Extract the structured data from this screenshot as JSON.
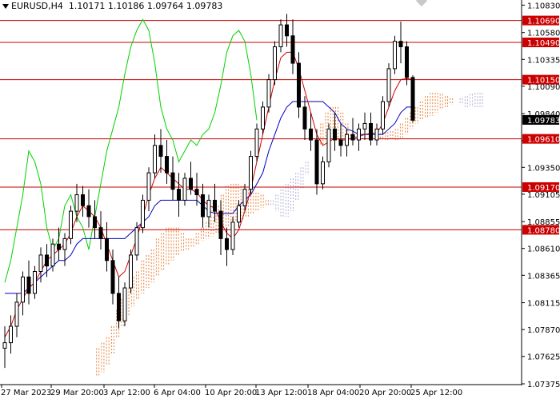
{
  "header": {
    "symbol": "EURUSD,H4",
    "ohlc": "1.10171 1.10186 1.09764 1.09783"
  },
  "chart_data": {
    "type": "candlestick",
    "indicator": "Ichimoku Kinko Hyo",
    "colors": {
      "tenkan": "#d00000",
      "kijun": "#0000c0",
      "chikou": "#00d000",
      "cloud": "#e8823a",
      "cloud_alt": "#b0b0d8",
      "candle": "#000000",
      "level": "#cc0000"
    },
    "ylim": [
      1.07375,
      1.10855
    ],
    "y_ticks": [
      "1.10830",
      "1.10580",
      "1.10335",
      "1.10090",
      "1.09840",
      "1.09595",
      "1.09350",
      "1.09105",
      "1.08855",
      "1.08610",
      "1.08365",
      "1.08115",
      "1.07870",
      "1.07625",
      "1.07375"
    ],
    "x_ticks": [
      "27 Mar 2023",
      "29 Mar 20:00",
      "3 Apr 12:00",
      "6 Apr 04:00",
      "10 Apr 20:00",
      "13 Apr 12:00",
      "18 Apr 04:00",
      "20 Apr 20:00",
      "25 Apr 12:00"
    ],
    "levels": [
      "1.10690",
      "1.10490",
      "1.10150",
      "1.09610",
      "1.09170",
      "1.08780"
    ],
    "current_price": "1.09783",
    "candles": [
      [
        1.077,
        1.079,
        1.0752,
        1.0775
      ],
      [
        1.0775,
        1.08,
        1.0765,
        1.079
      ],
      [
        1.079,
        1.082,
        1.078,
        1.0812
      ],
      [
        1.0812,
        1.084,
        1.08,
        1.0835
      ],
      [
        1.0835,
        1.085,
        1.081,
        1.082
      ],
      [
        1.082,
        1.0845,
        1.0815,
        1.084
      ],
      [
        1.084,
        1.0862,
        1.083,
        1.0855
      ],
      [
        1.0855,
        1.0865,
        1.0835,
        1.0845
      ],
      [
        1.0845,
        1.087,
        1.084,
        1.0865
      ],
      [
        1.0865,
        1.088,
        1.085,
        1.086
      ],
      [
        1.086,
        1.0875,
        1.0845,
        1.087
      ],
      [
        1.087,
        1.09,
        1.0865,
        1.0895
      ],
      [
        1.0895,
        1.092,
        1.0885,
        1.091
      ],
      [
        1.091,
        1.0918,
        1.089,
        1.09
      ],
      [
        1.09,
        1.0915,
        1.088,
        1.089
      ],
      [
        1.089,
        1.0905,
        1.087,
        1.088
      ],
      [
        1.088,
        1.0895,
        1.086,
        1.087
      ],
      [
        1.087,
        1.0885,
        1.084,
        1.085
      ],
      [
        1.085,
        1.086,
        1.081,
        1.082
      ],
      [
        1.082,
        1.0835,
        1.0788,
        1.0795
      ],
      [
        1.0795,
        1.083,
        1.079,
        1.0825
      ],
      [
        1.0825,
        1.086,
        1.082,
        1.0855
      ],
      [
        1.0855,
        1.0885,
        1.085,
        1.088
      ],
      [
        1.088,
        1.091,
        1.0875,
        1.0905
      ],
      [
        1.0905,
        1.0935,
        1.0895,
        1.093
      ],
      [
        1.093,
        1.0965,
        1.0925,
        1.0955
      ],
      [
        1.0955,
        1.097,
        1.093,
        1.0945
      ],
      [
        1.0945,
        1.096,
        1.092,
        1.093
      ],
      [
        1.093,
        1.0945,
        1.0905,
        1.0915
      ],
      [
        1.0915,
        1.093,
        1.089,
        1.0905
      ],
      [
        1.0905,
        1.093,
        1.09,
        1.0925
      ],
      [
        1.0925,
        1.094,
        1.091,
        1.0915
      ],
      [
        1.0915,
        1.093,
        1.09,
        1.091
      ],
      [
        1.091,
        1.092,
        1.088,
        1.089
      ],
      [
        1.089,
        1.091,
        1.088,
        1.0905
      ],
      [
        1.0905,
        1.092,
        1.0885,
        1.0895
      ],
      [
        1.0895,
        1.0905,
        1.0855,
        1.087
      ],
      [
        1.087,
        1.088,
        1.0845,
        1.086
      ],
      [
        1.086,
        1.089,
        1.0855,
        1.0885
      ],
      [
        1.0885,
        1.0905,
        1.088,
        1.09
      ],
      [
        1.09,
        1.092,
        1.0895,
        1.0915
      ],
      [
        1.0915,
        1.095,
        1.091,
        1.0945
      ],
      [
        1.0945,
        1.0975,
        1.094,
        1.097
      ],
      [
        1.097,
        1.0995,
        1.0965,
        1.099
      ],
      [
        1.099,
        1.102,
        1.0985,
        1.1015
      ],
      [
        1.1015,
        1.105,
        1.101,
        1.1045
      ],
      [
        1.1045,
        1.107,
        1.104,
        1.1065
      ],
      [
        1.1065,
        1.1075,
        1.1045,
        1.1055
      ],
      [
        1.1055,
        1.107,
        1.102,
        1.103
      ],
      [
        1.103,
        1.104,
        1.098,
        1.099
      ],
      [
        1.099,
        1.1,
        1.096,
        1.097
      ],
      [
        1.097,
        1.0985,
        1.095,
        1.096
      ],
      [
        1.096,
        1.097,
        1.091,
        1.092
      ],
      [
        1.092,
        1.0945,
        1.0915,
        1.094
      ],
      [
        1.094,
        1.0975,
        1.0935,
        1.097
      ],
      [
        1.097,
        1.0985,
        1.095,
        1.096
      ],
      [
        1.096,
        1.0975,
        1.0945,
        1.0955
      ],
      [
        1.0955,
        1.097,
        1.0945,
        1.0965
      ],
      [
        1.0965,
        1.098,
        1.0955,
        1.096
      ],
      [
        1.096,
        1.0975,
        1.095,
        1.097
      ],
      [
        1.097,
        1.0985,
        1.096,
        1.0975
      ],
      [
        1.0975,
        1.0985,
        1.0955,
        1.096
      ],
      [
        1.096,
        1.0975,
        1.0955,
        1.097
      ],
      [
        1.097,
        1.1,
        1.0965,
        1.0995
      ],
      [
        1.0995,
        1.103,
        1.099,
        1.1025
      ],
      [
        1.1025,
        1.1055,
        1.102,
        1.105
      ],
      [
        1.105,
        1.1068,
        1.103,
        1.1045
      ],
      [
        1.1045,
        1.105,
        1.101,
        1.1017
      ],
      [
        1.1017,
        1.1019,
        1.0976,
        1.0978
      ]
    ],
    "tenkan": [
      1.078,
      1.079,
      1.0805,
      1.0815,
      1.0825,
      1.083,
      1.084,
      1.085,
      1.0855,
      1.086,
      1.0865,
      1.0875,
      1.089,
      1.09,
      1.0895,
      1.089,
      1.088,
      1.0865,
      1.085,
      1.0835,
      1.084,
      1.0855,
      1.087,
      1.089,
      1.091,
      1.0925,
      1.0935,
      1.093,
      1.0925,
      1.092,
      1.0915,
      1.0915,
      1.0912,
      1.0905,
      1.09,
      1.0898,
      1.0885,
      1.0875,
      1.087,
      1.0878,
      1.0895,
      1.0915,
      1.094,
      1.0965,
      1.099,
      1.1015,
      1.1035,
      1.104,
      1.104,
      1.1025,
      1.1005,
      1.0985,
      1.0965,
      1.0955,
      1.0958,
      1.0962,
      1.096,
      1.096,
      1.0962,
      1.0963,
      1.0965,
      1.0966,
      1.0966,
      1.0975,
      1.099,
      1.1005,
      1.1015,
      1.1016,
      1.1015
    ],
    "kijun": [
      1.082,
      1.082,
      1.082,
      1.082,
      1.0825,
      1.083,
      1.0835,
      1.084,
      1.0845,
      1.085,
      1.085,
      1.0855,
      1.0865,
      1.087,
      1.087,
      1.087,
      1.087,
      1.087,
      1.087,
      1.087,
      1.087,
      1.0875,
      1.088,
      1.0885,
      1.089,
      1.09,
      1.0905,
      1.0905,
      1.0905,
      1.0905,
      1.0905,
      1.0905,
      1.0905,
      1.09,
      1.0895,
      1.0893,
      1.0893,
      1.0893,
      1.0893,
      1.09,
      1.0905,
      1.091,
      1.092,
      1.093,
      1.095,
      1.0965,
      1.098,
      1.099,
      1.0995,
      1.0995,
      1.0995,
      1.0995,
      1.0995,
      1.0995,
      1.099,
      1.0985,
      1.0975,
      1.097,
      1.0968,
      1.0965,
      1.0965,
      1.0965,
      1.0965,
      1.0965,
      1.097,
      1.0975,
      1.0985,
      1.099,
      1.099
    ],
    "chikou": [
      1.083,
      1.085,
      1.088,
      1.091,
      1.095,
      1.094,
      1.092,
      1.088,
      1.086,
      1.087,
      1.09,
      1.091,
      1.089,
      1.088,
      1.086,
      1.089,
      1.092,
      1.095,
      1.097,
      1.099,
      1.102,
      1.1045,
      1.106,
      1.107,
      1.106,
      1.103,
      1.099,
      1.097,
      1.096,
      1.094,
      1.095,
      1.096,
      1.0955,
      1.0965,
      1.097,
      1.0985,
      1.101,
      1.104,
      1.1055,
      1.106,
      1.105,
      1.102,
      1.0978
    ],
    "senkou_a": [
      1.077,
      1.0775,
      1.078,
      1.079,
      1.0805,
      1.0815,
      1.0825,
      1.0835,
      1.084,
      1.085,
      1.0855,
      1.086,
      1.087,
      1.0875,
      1.088,
      1.088,
      1.088,
      1.0875,
      1.087,
      1.087,
      1.0875,
      1.088,
      1.0885,
      1.089,
      1.09,
      1.091,
      1.0918,
      1.092,
      1.092,
      1.0918,
      1.0915,
      1.0915,
      1.0912,
      1.091,
      1.0905,
      1.09,
      1.0895,
      1.089,
      1.089,
      1.0895,
      1.0905,
      1.0915,
      1.0928,
      1.0945,
      1.096,
      1.0975,
      1.0985,
      1.099,
      1.099,
      1.0985,
      1.0975,
      1.0965,
      1.096,
      1.096,
      1.0962,
      1.0963,
      1.0965,
      1.0966,
      1.0967,
      1.0968,
      1.097,
      1.0975,
      1.098,
      1.0985,
      1.099,
      1.0995,
      1.1,
      1.1003,
      1.1003,
      1.1002,
      1.1,
      1.0998,
      1.0995,
      1.0992,
      1.099,
      1.099,
      1.099,
      1.099
    ],
    "senkou_b": [
      1.0745,
      1.0748,
      1.0755,
      1.0765,
      1.078,
      1.079,
      1.08,
      1.0808,
      1.0815,
      1.082,
      1.0825,
      1.083,
      1.0835,
      1.084,
      1.0845,
      1.085,
      1.0855,
      1.0858,
      1.086,
      1.0862,
      1.0865,
      1.0868,
      1.087,
      1.0872,
      1.0875,
      1.0878,
      1.088,
      1.0882,
      1.0885,
      1.0888,
      1.089,
      1.0893,
      1.0895,
      1.0898,
      1.09,
      1.0905,
      1.091,
      1.0915,
      1.092,
      1.0925,
      1.093,
      1.0935,
      1.094,
      1.0945,
      1.095,
      1.0955,
      1.0958,
      1.096,
      1.096,
      1.096,
      1.096,
      1.096,
      1.096,
      1.0962,
      1.0962,
      1.0962,
      1.0962,
      1.096,
      1.096,
      1.096,
      1.096,
      1.0962,
      1.0965,
      1.097,
      1.0975,
      1.0978,
      1.098,
      1.0982,
      1.0985,
      1.0988,
      1.099,
      1.0992,
      1.0995,
      1.0998,
      1.1,
      1.1002,
      1.1003,
      1.1003
    ]
  }
}
